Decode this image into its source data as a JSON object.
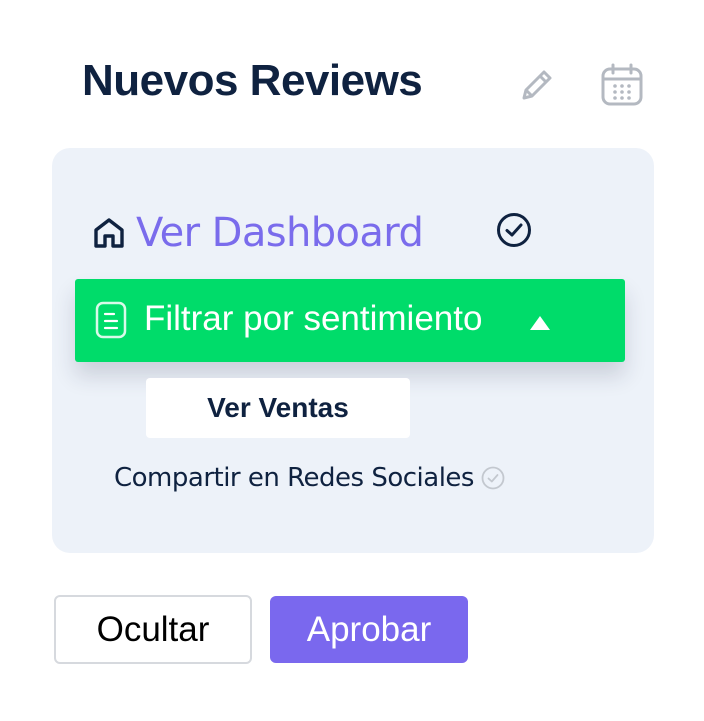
{
  "header": {
    "title": "Nuevos Reviews",
    "icons": [
      "pencil-icon",
      "calendar-icon"
    ]
  },
  "menu": {
    "dashboard_label": "Ver Dashboard",
    "dashboard_icon": "home-icon",
    "dashboard_status_icon": "check-circle-icon",
    "filter_label": "Filtrar por sentimiento",
    "filter_icon": "document-icon",
    "filter_state_icon": "caret-up-icon",
    "sales_label": "Ver Ventas",
    "share_label": "Compartir en Redes Sociales",
    "share_status_icon": "check-circle-icon"
  },
  "actions": {
    "hide_label": "Ocultar",
    "approve_label": "Aprobar"
  },
  "colors": {
    "heading": "#0f2240",
    "accent_purple": "#7a68ee",
    "active_green": "#00dc6a",
    "panel_bg": "#edf2f9",
    "muted_icon": "#b4b9c1"
  }
}
